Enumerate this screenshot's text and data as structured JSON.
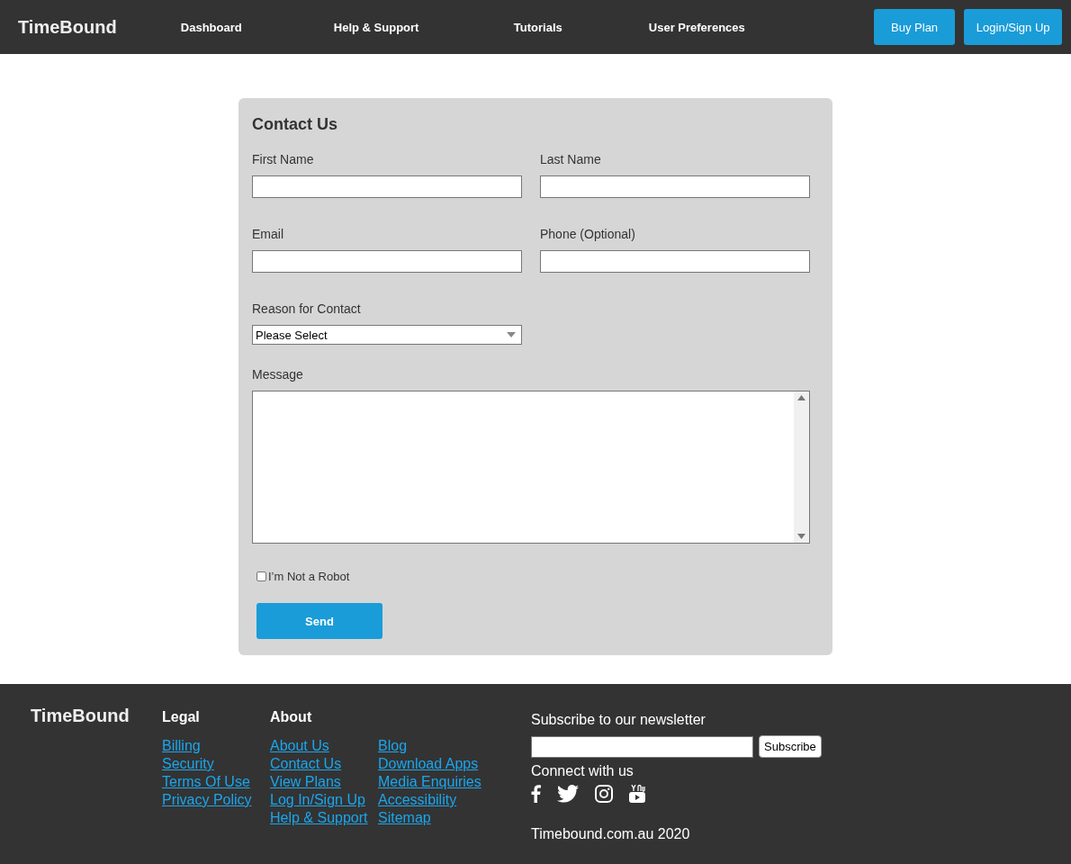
{
  "header": {
    "logo": "TimeBound",
    "nav": [
      "Dashboard",
      "Help & Support",
      "Tutorials",
      "User Preferences"
    ],
    "buttons": [
      "Buy Plan",
      "Login/Sign Up"
    ]
  },
  "form": {
    "title": "Contact Us",
    "fields": [
      {
        "kind": "text",
        "label": "First Name"
      },
      {
        "kind": "text",
        "label": "Last Name"
      },
      {
        "kind": "text",
        "label": "Email"
      },
      {
        "kind": "text",
        "label": "Phone (Optional)"
      },
      {
        "kind": "select",
        "label": "Reason for Contact",
        "value": "Please Select"
      },
      {
        "kind": "textarea",
        "label": "Message"
      }
    ],
    "robot_check": {
      "label": "I’m Not a Robot",
      "checked": false
    },
    "submit": "Send"
  },
  "footer": {
    "logo": "TimeBound",
    "columns": [
      {
        "heading": "Legal",
        "links": [
          "Billing",
          "Security",
          "Terms Of Use",
          "Privacy Policy"
        ]
      },
      {
        "heading": "About",
        "links": [
          "About Us",
          "Contact Us",
          "View Plans",
          "Log In/Sign Up",
          "Help & Support"
        ]
      },
      {
        "links": [
          "Blog",
          "Download Apps",
          "Media Enquiries",
          "Accessibility",
          "Sitemap"
        ]
      }
    ],
    "newsletter": {
      "title": "Subscribe to our newsletter",
      "button": "Subscribe"
    },
    "connect": "Connect with us",
    "copyright": "Timebound.com.au 2020"
  }
}
